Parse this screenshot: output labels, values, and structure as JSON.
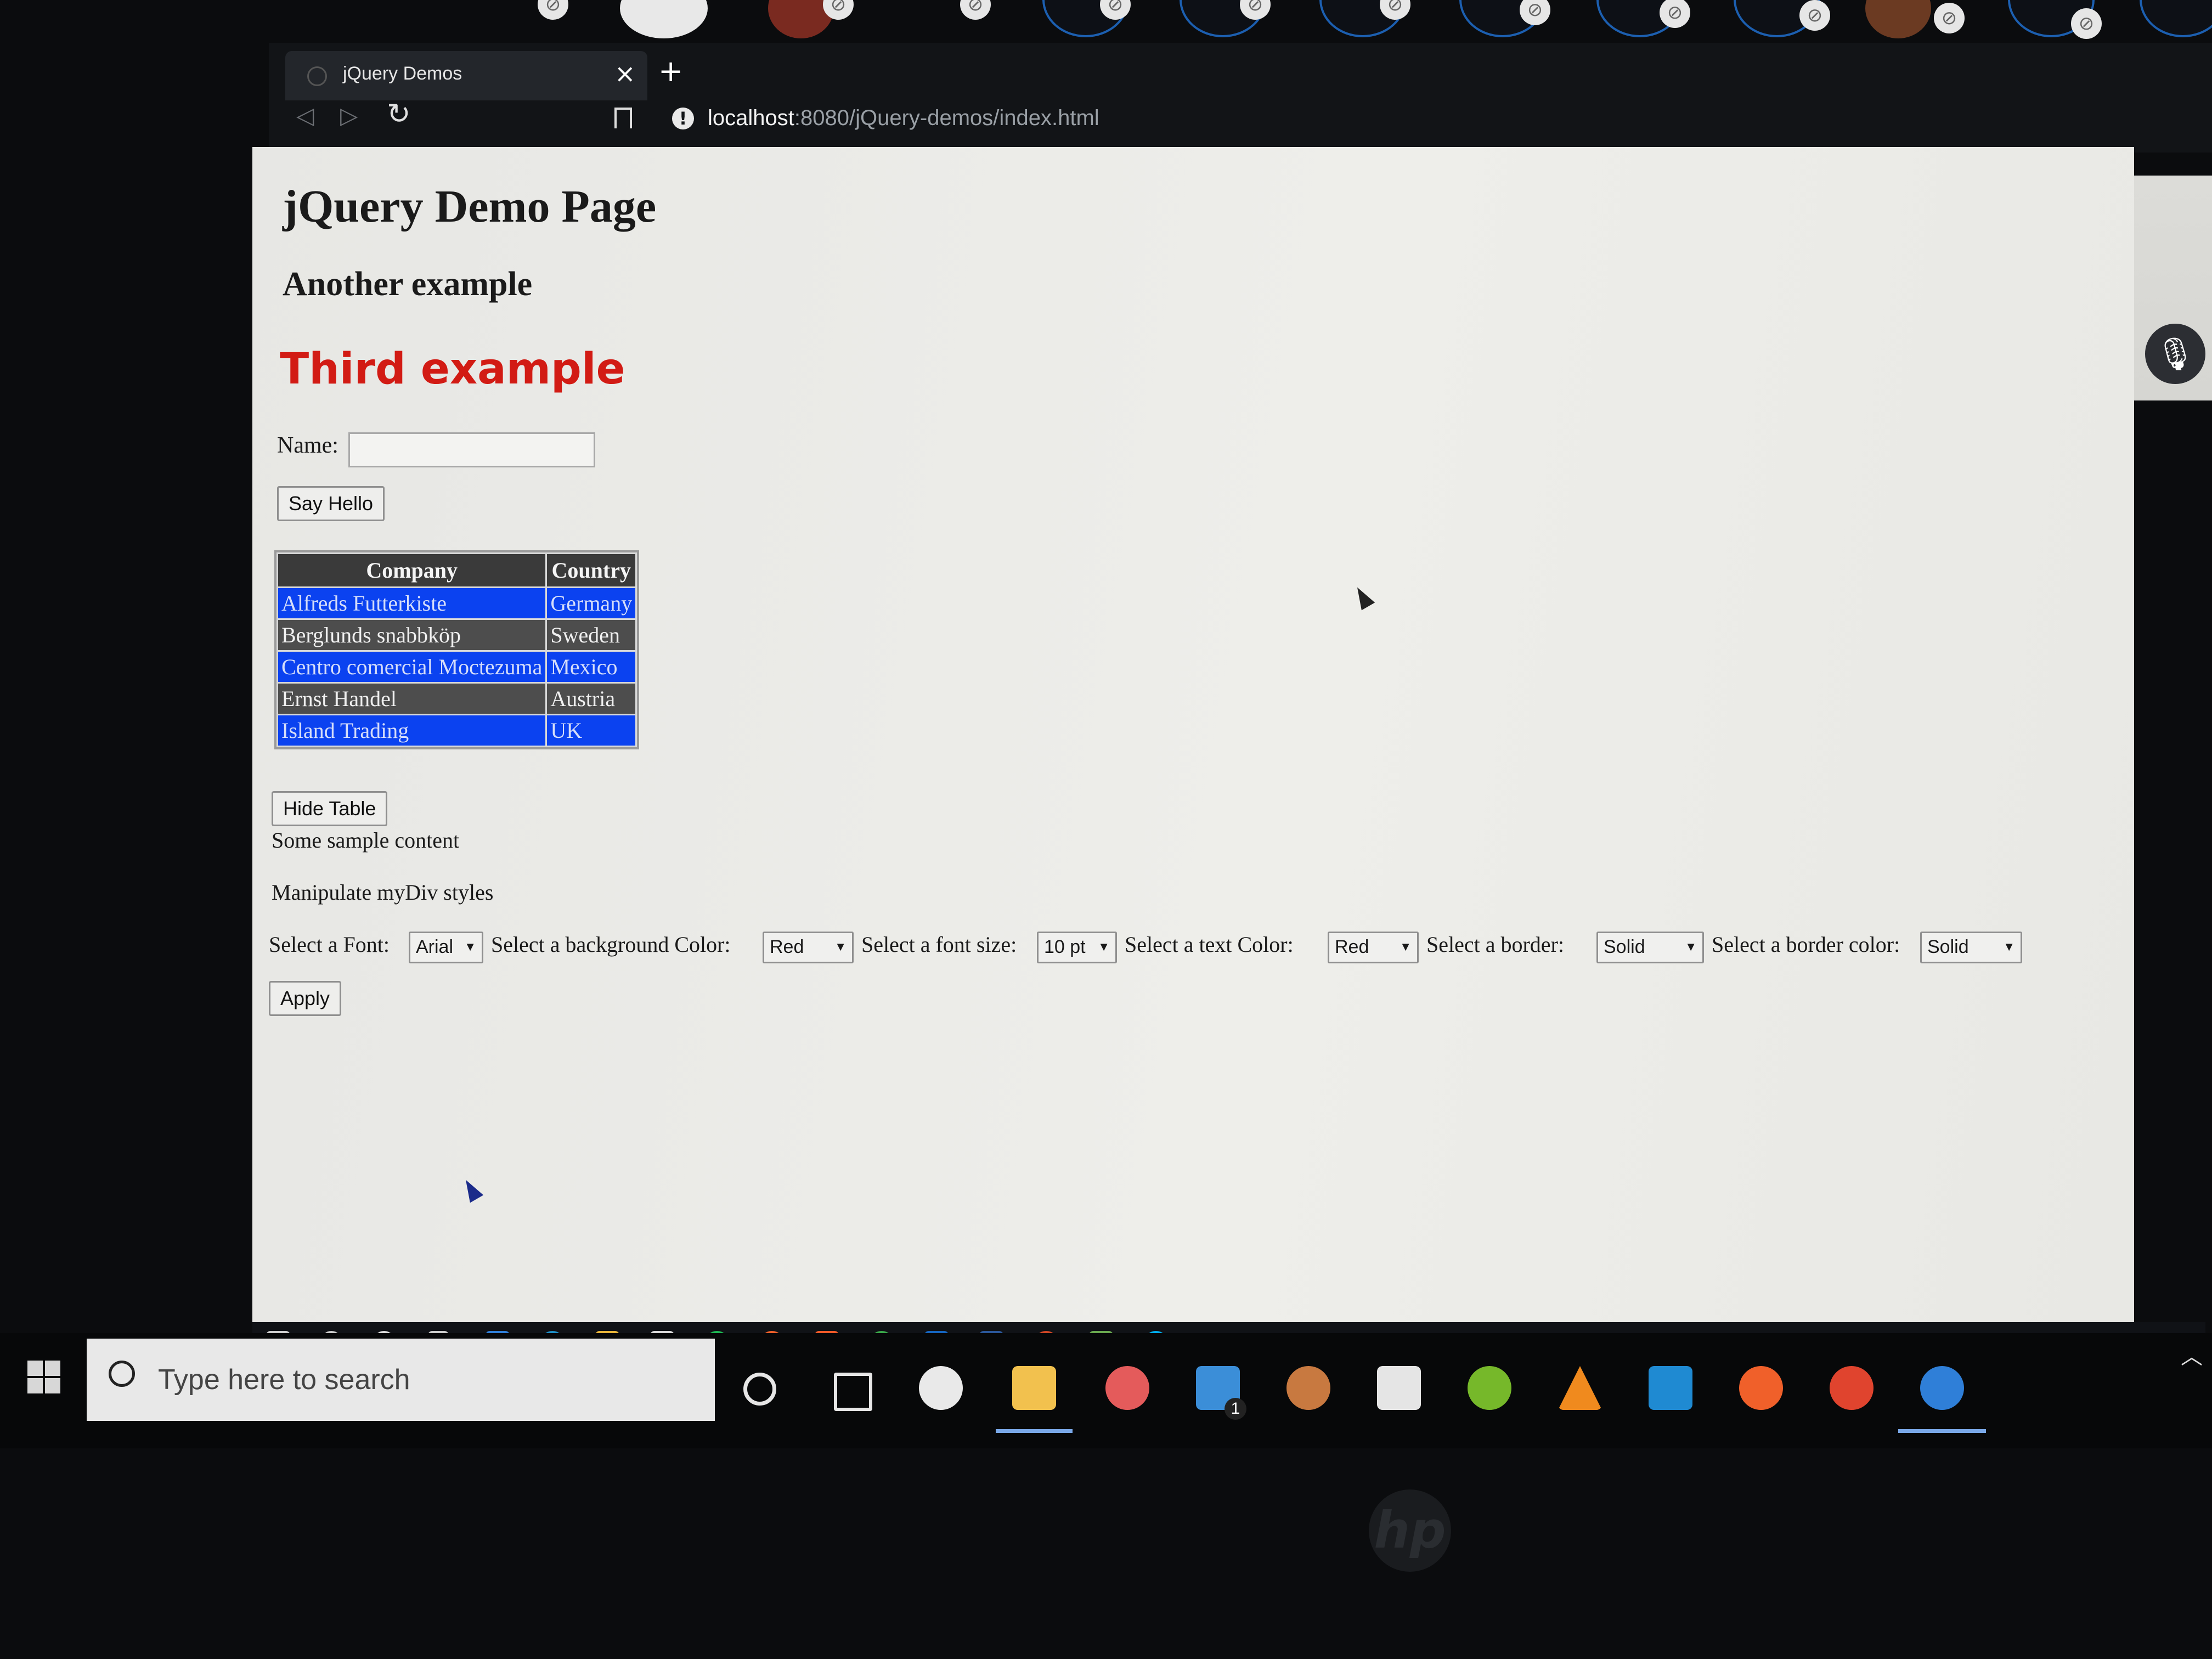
{
  "browser": {
    "tab_title": "jQuery Demos",
    "tab_close": "×",
    "new_tab": "+",
    "address_host": "localhost",
    "address_path": ":8080/jQuery-demos/index.html"
  },
  "page": {
    "title": "jQuery Demo Page",
    "subtitle": "Another example",
    "third": "Third example",
    "name_label": "Name:",
    "name_value": "",
    "say_hello": "Say Hello",
    "table": {
      "headers": [
        "Company",
        "Country"
      ],
      "rows": [
        [
          "Alfreds Futterkiste",
          "Germany"
        ],
        [
          "Berglunds snabbköp",
          "Sweden"
        ],
        [
          "Centro comercial Moctezuma",
          "Mexico"
        ],
        [
          "Ernst Handel",
          "Austria"
        ],
        [
          "Island Trading",
          "UK"
        ]
      ]
    },
    "hide_table": "Hide Table",
    "sample_content": "Some sample content",
    "manipulate": "Manipulate myDiv styles",
    "controls": {
      "font_label": "Select a Font:",
      "font_value": "Arial",
      "bg_label": "Select a background Color:",
      "bg_value": "Red",
      "size_label": "Select a font size:",
      "size_value": "10 pt",
      "text_color_label": "Select a text Color:",
      "text_color_value": "Red",
      "border_label": "Select a border:",
      "border_value": "Solid",
      "border_color_label": "Select a border color:",
      "border_color_value": "Solid"
    },
    "apply": "Apply"
  },
  "taskbar": {
    "search_placeholder": "Type here to search",
    "mail_badge": "1"
  },
  "colors": {
    "heading_red": "#d21b14",
    "row_blue": "#0b42f0",
    "row_gray": "#4d4d4d"
  }
}
